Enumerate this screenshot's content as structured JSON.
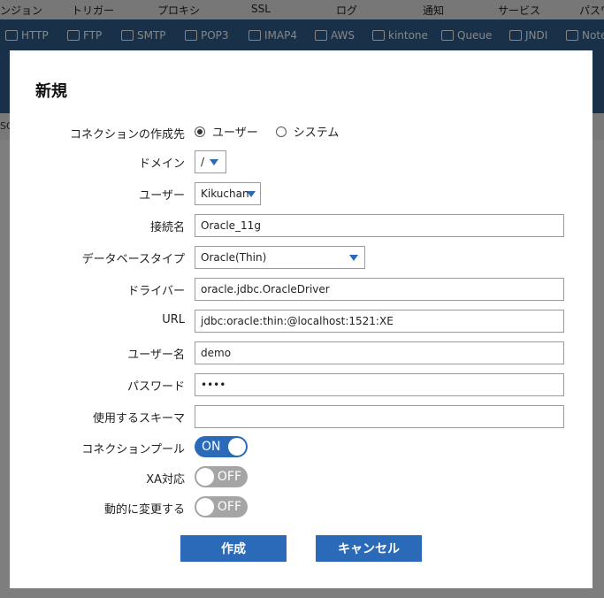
{
  "topnav": {
    "tabs": [
      "ンジョン",
      "トリガー",
      "プロキシ",
      "SSL",
      "ログ",
      "通知",
      "サービス",
      "パスワ"
    ]
  },
  "subnav": {
    "items": [
      {
        "label": "HTTP",
        "icon": "http-icon"
      },
      {
        "label": "FTP",
        "icon": "ftp-icon"
      },
      {
        "label": "SMTP",
        "icon": "smtp-icon"
      },
      {
        "label": "POP3",
        "icon": "pop3-icon"
      },
      {
        "label": "IMAP4",
        "icon": "imap4-icon"
      },
      {
        "label": "AWS",
        "icon": "aws-icon"
      },
      {
        "label": "kintone",
        "icon": "kintone-icon"
      },
      {
        "label": "Queue",
        "icon": "queue-icon"
      },
      {
        "label": "JNDI",
        "icon": "jndi-icon"
      },
      {
        "label": "Note",
        "icon": "note-icon"
      }
    ]
  },
  "background": {
    "side_fragment": "SQ"
  },
  "dialog": {
    "title": "新規",
    "connection_target": {
      "label": "コネクションの作成先",
      "options": [
        "ユーザー",
        "システム"
      ],
      "selected": "ユーザー"
    },
    "domain": {
      "label": "ドメイン",
      "value": "/"
    },
    "user": {
      "label": "ユーザー",
      "value": "Kikuchan"
    },
    "connection_name": {
      "label": "接続名",
      "value": "Oracle_11g"
    },
    "db_type": {
      "label": "データベースタイプ",
      "value": "Oracle(Thin)"
    },
    "driver": {
      "label": "ドライバー",
      "value": "oracle.jdbc.OracleDriver"
    },
    "url": {
      "label": "URL",
      "value": "jdbc:oracle:thin:@localhost:1521:XE"
    },
    "username": {
      "label": "ユーザー名",
      "value": "demo"
    },
    "password": {
      "label": "パスワード",
      "value": "••••"
    },
    "schema": {
      "label": "使用するスキーマ",
      "value": ""
    },
    "connection_pool": {
      "label": "コネクションプール",
      "state": "ON"
    },
    "xa": {
      "label": "XA対応",
      "state": "OFF"
    },
    "dynamic_change": {
      "label": "動的に変更する",
      "state": "OFF"
    },
    "create_button": "作成",
    "cancel_button": "キャンセル"
  },
  "colors": {
    "accent": "#2a6ab8",
    "toggle_off": "#a5a5a5",
    "nav_blue": "#2f5f8a"
  }
}
